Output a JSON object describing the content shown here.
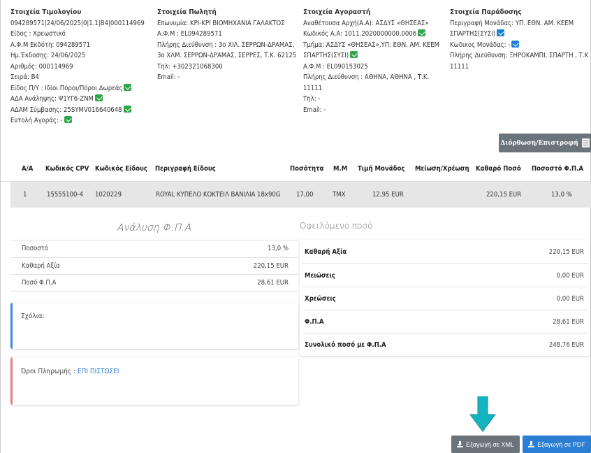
{
  "invoice": {
    "title": "Στοιχεία Τιμολογίου",
    "lines": [
      "094289571|24/06/2025|0|1.1|B4|000114969",
      "Είδος : Χρεωστικό",
      "Α.Φ.Μ Εκδότη: 094289571",
      "Ημ.Έκδοσης: 24/06/2025",
      "Αριθμός: 000114969",
      "Σειρά: B4"
    ],
    "budget_type": "Είδος Π/Υ : Ιδίοι Πόροι/Πόροι Δωρεάς",
    "ada_commit": "ΑΔΑ Ανάληψης: Ψ1ΥΓ6-ΖΝΜ",
    "adam_contract": "ΑΔΑΜ Σύμβασης: 25SYMV016640648",
    "purchase_order": "Εντολή Αγοράς: -"
  },
  "seller": {
    "title": "Στοιχεία Πωλητή",
    "name": "Επωνυμία: ΚΡΙ-ΚΡΙ ΒΙΟΜΗΧΑΝΙΑ ΓΑΛΑΚΤΟΣ",
    "afm": "Α.Φ.Μ : EL094289571",
    "address1": "Πλήρης Διεύθυνση : 3ο ΧΙΛ. ΣΕΡΡΩΝ-ΔΡΑΜΑΣ,",
    "address2": "3ο ΧΛΜ. ΣΕΡΡΩΝ-ΔΡΑΜΑΣ, ΣΕΡΡΕΣ, Τ.Κ. 62125",
    "phone": "Τηλ: +302321068300",
    "email": "Email: -"
  },
  "buyer": {
    "title": "Στοιχεία Αγοραστή",
    "authority": "Αναθέτουσα Αρχή(Α.Α): ΑΣΔΥΣ «ΘΗΣΕΑΣ»",
    "aa_code": "Κωδικός Α.Α: 1011.2020000000.0006",
    "dept1": "Τμήμα: ΑΣΔΥΣ «ΘΗΣΕΑΣ»,ΥΠ. ΕΘΝ. ΑΜ. ΚΕΕΜ",
    "dept2": "ΣΠΑΡΤΗΣ(ΣΥΣΙ)",
    "afm": "Α.Φ.Μ : EL090153025",
    "address1": "Πλήρης Διεύθυνση : ΑΘΗΝΑ, ΑΘΗΝΑ , Τ.Κ.",
    "address2": "11111",
    "phone": "Τηλ: -",
    "email": "Email: -"
  },
  "delivery": {
    "title": "Στοιχεία Παράδοσης",
    "unit1": "Περιγραφή Μονάδας: ΥΠ. ΕΘΝ. ΑΜ. ΚΕΕΜ",
    "unit2": "ΣΠΑΡΤΗΣ(ΣΥΣΙ)",
    "unit_code": "Κωδικος Μονάδας: -",
    "address1": "Πλήρης Διεύθυνση: ΞΗΡΟΚΑΜΠΙ, ΣΠΑΡΤΗ , Τ.Κ",
    "address2": "11111"
  },
  "correction_button": "Διόρθωση/Επιστροφή",
  "table": {
    "headers": {
      "aa": "Α/Α",
      "cpv": "Κωδικός CPV",
      "item_code": "Κωδικός Είδους",
      "description": "Περιγραφή Είδους",
      "quantity": "Ποσότητα",
      "unit": "Μ.Μ",
      "unit_price": "Τιμή Μονάδος",
      "discount": "Μείωση/Χρέωση",
      "net": "Καθαρό Ποσό",
      "vat_pct": "Ποσοστό Φ.Π.Α"
    },
    "rows": [
      {
        "aa": "1",
        "cpv": "15555100-4",
        "item_code": "1020229",
        "description": "ROYAL ΚΥΠΕΛΟ ΚΟΚΤΕΙΛ ΒΑΝΙΛΙΑ 18x90G",
        "quantity": "17,00",
        "unit": "TMX",
        "unit_price": "12,95 EUR",
        "discount": "",
        "net": "220,15 EUR",
        "vat_pct": "13,0 %"
      }
    ]
  },
  "vat_analysis": {
    "title": "Ανάλυση Φ.Π.Α",
    "rows": [
      {
        "label": "Ποσοστό",
        "value": "13,0 %"
      },
      {
        "label": "Καθαρή Αξία",
        "value": "220,15 EUR"
      },
      {
        "label": "Ποσό Φ.Π.Α",
        "value": "28,61 EUR"
      }
    ]
  },
  "comments": {
    "label": "Σχόλια:",
    "accent": "#3b8fe0"
  },
  "payment_terms": {
    "label": "Όροι Πληρωμής :",
    "value": "ΕΠΙ ΠΙΣΤΩΣΕΙ",
    "accent": "#e88080"
  },
  "owed": {
    "title": "Οφειλόμενο ποσό",
    "rows": [
      {
        "label": "Καθαρή Αξία",
        "value": "220,15 EUR"
      },
      {
        "label": "Μειώσεις",
        "value": "0,00 EUR"
      },
      {
        "label": "Χρεώσεις",
        "value": "0,00 EUR"
      },
      {
        "label": "Φ.Π.Α",
        "value": "28,61 EUR"
      },
      {
        "label": "Συνολικό ποσό με Φ.Π.Α",
        "value": "248,76 EUR"
      }
    ]
  },
  "export": {
    "xml": "Εξαγωγή σε XML",
    "pdf": "Εξαγωγή σε PDF"
  },
  "colors": {
    "accent_blue": "#2a7fd4",
    "edit_green": "#2fa64a",
    "arrow_teal": "#14b3c0",
    "gray_button": "#6b737b"
  }
}
